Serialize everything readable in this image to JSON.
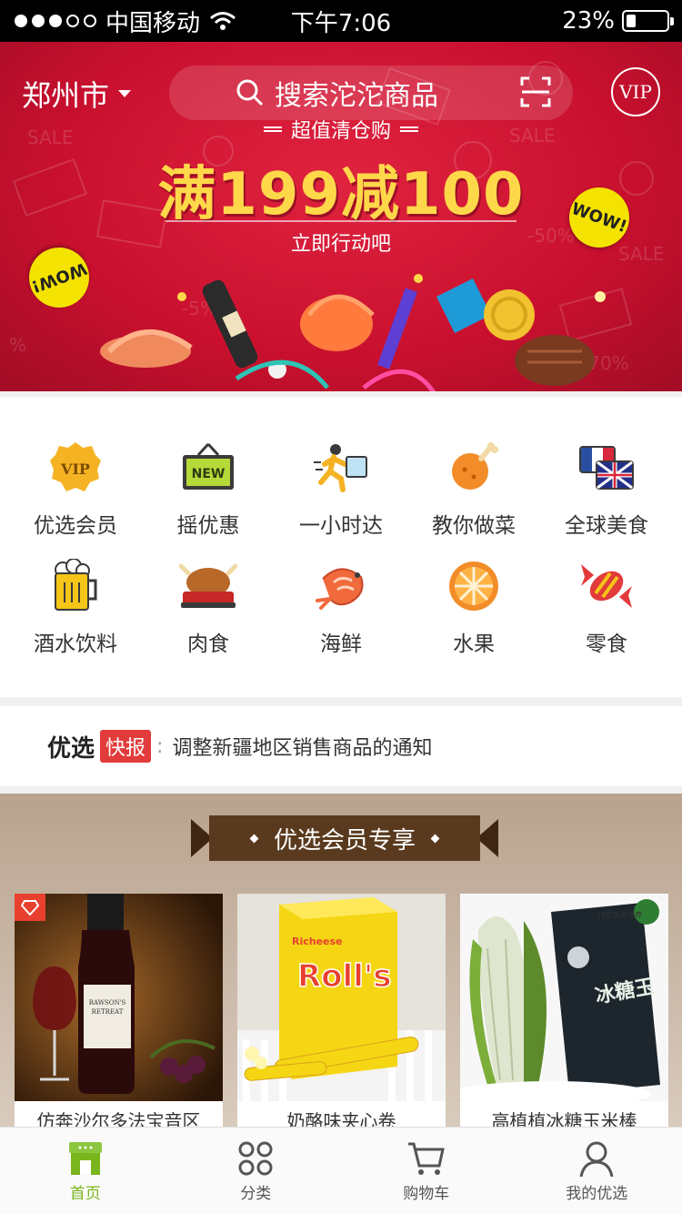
{
  "status_bar": {
    "carrier": "中国移动",
    "time": "下午7:06",
    "battery": "23%",
    "battery_level": 0.23
  },
  "header": {
    "city": "郑州市",
    "search_placeholder": "搜索沱沱商品",
    "vip_label": "VIP"
  },
  "banner": {
    "subtitle": "超值清仓购",
    "headline": "满199减100",
    "cta": "立即行动吧",
    "sticker_left": "WOW!",
    "sticker_right": "WOW!"
  },
  "categories": [
    {
      "label": "优选会员",
      "icon": "vip-badge-icon"
    },
    {
      "label": "摇优惠",
      "icon": "new-sign-icon"
    },
    {
      "label": "一小时达",
      "icon": "running-courier-icon"
    },
    {
      "label": "教你做菜",
      "icon": "drumstick-icon"
    },
    {
      "label": "全球美食",
      "icon": "flags-icon"
    },
    {
      "label": "酒水饮料",
      "icon": "beer-mug-icon"
    },
    {
      "label": "肉食",
      "icon": "roast-chicken-icon"
    },
    {
      "label": "海鲜",
      "icon": "shrimp-icon"
    },
    {
      "label": "水果",
      "icon": "orange-slice-icon"
    },
    {
      "label": "零食",
      "icon": "candy-icon"
    }
  ],
  "news": {
    "brand": "优选",
    "tag": "快报",
    "colon": ":",
    "text": "调整新疆地区销售商品的通知"
  },
  "member_section": {
    "title": "优选会员专享",
    "products": [
      {
        "title": "仿奔沙尔多法宝音区",
        "image": "red-wine-image"
      },
      {
        "title": "奶酪味夹心卷",
        "image": "rolls-snack-image"
      },
      {
        "title": "高植植冰糖玉米棒",
        "image": "corn-image"
      }
    ]
  },
  "tabbar": {
    "items": [
      {
        "label": "首页",
        "icon": "home-icon",
        "active": true
      },
      {
        "label": "分类",
        "icon": "category-icon",
        "active": false
      },
      {
        "label": "购物车",
        "icon": "cart-icon",
        "active": false
      },
      {
        "label": "我的优选",
        "icon": "user-icon",
        "active": false
      }
    ]
  },
  "colors": {
    "banner_red": "#c8102e",
    "headline_yellow": "#ffd84a",
    "accent_green": "#7ab51d",
    "news_tag_red": "#e23b3b",
    "ribbon_brown": "#5a3a1e"
  }
}
